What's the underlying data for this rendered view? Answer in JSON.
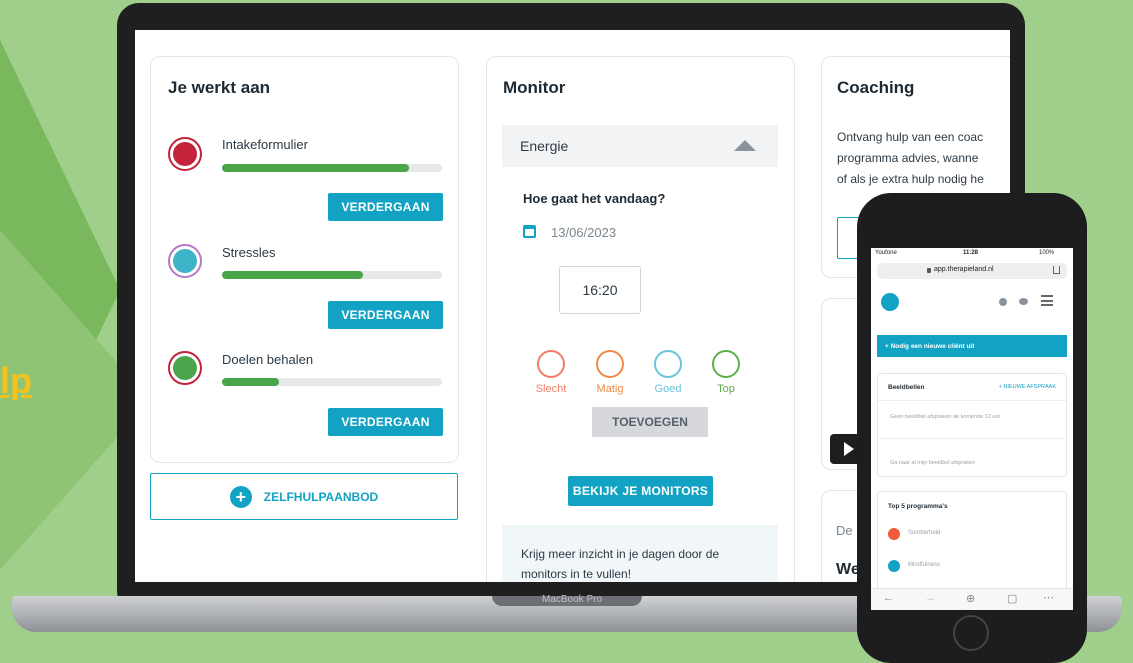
{
  "background": {
    "link_text": "lp",
    "accent": "#f4c21a"
  },
  "laptop": {
    "brand": "MacBook Pro"
  },
  "work": {
    "title": "Je werkt aan",
    "items": [
      {
        "label": "Intakeformulier",
        "progress": 0.85,
        "button": "VERDERGAAN",
        "icon": "form-icon",
        "color": "#c4223a"
      },
      {
        "label": "Stressles",
        "progress": 0.64,
        "button": "VERDERGAAN",
        "icon": "stress-icon",
        "color": "#3fb3c8"
      },
      {
        "label": "Doelen behalen",
        "progress": 0.26,
        "button": "VERDERGAAN",
        "icon": "target-icon",
        "color": "#4aa54a"
      }
    ],
    "zelfhulp": "ZELFHULPAANBOD"
  },
  "monitor": {
    "title": "Monitor",
    "accordion": "Energie",
    "question": "Hoe gaat het vandaag?",
    "date": "13/06/2023",
    "time": "16:20",
    "moods": [
      {
        "label": "Slecht",
        "color": "#ef7e6a"
      },
      {
        "label": "Matig",
        "color": "#f08a45"
      },
      {
        "label": "Goed",
        "color": "#6cc3de"
      },
      {
        "label": "Top",
        "color": "#5fae4a"
      }
    ],
    "add": "TOEVOEGEN",
    "view": "BEKIJK JE MONITORS",
    "info": "Krijg meer inzicht in je dagen door de monitors in te vullen!"
  },
  "coaching": {
    "title": "Coaching",
    "lines": [
      "Ontvang hulp van een coac",
      "programma advies, wanne",
      "of als je extra hulp nodig he"
    ],
    "button_frag": "B",
    "frag1": "De",
    "frag2": "We"
  },
  "phone": {
    "status": {
      "carrier": "Youfone",
      "time": "11:28",
      "battery": "100%"
    },
    "url": "app.therapieland.nl",
    "invite": "+  Nodig een nieuwe cliënt uit",
    "beeldbellen": {
      "title": "Beeldbellen",
      "new": "+ NIEUWE AFSPRAAK",
      "empty": "Geen beeldbel afspraken de komende 12 uur",
      "link": "Ga naar al mijn beeldbel afspraken"
    },
    "top5": {
      "title": "Top 5 programma's",
      "items": [
        "Somberheid",
        "Mindfulness"
      ]
    }
  }
}
